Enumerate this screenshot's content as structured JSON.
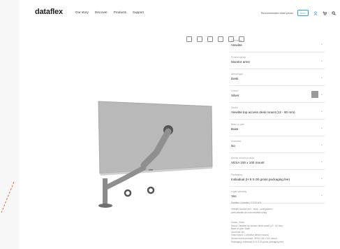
{
  "header": {
    "logo": "dataflex",
    "nav": [
      "Our story",
      "Discover",
      "Products",
      "Support"
    ],
    "price_label": "Recommended retail prices",
    "toggle": "EXCL"
  },
  "configurator": {
    "options": [
      {
        "key": "Collection",
        "value": "Viewlite"
      },
      {
        "key": "Product group",
        "value": "Monitor arms"
      },
      {
        "key": "Arrival type",
        "value": "Desk"
      },
      {
        "key": "Colour",
        "value": "Silver"
      },
      {
        "key": "Mount",
        "value": "Viewlite top access desk mount (12 - 60 mm)"
      },
      {
        "key": "Base or pole",
        "value": "Base"
      },
      {
        "key": "Grommet",
        "value": "No"
      },
      {
        "key": "Device mount product",
        "value": "VESA 100 x 100 mount"
      },
      {
        "key": "Packaging",
        "value": "Individual (H 6 S 00 gross packaging fee)"
      },
      {
        "key": "Legal warranty",
        "value": "Yes"
      }
    ],
    "summary_title": "Dataflex | Viewlite | 3 TOS 601",
    "summary_lines": [
      "Viewlite monitor arm - desk - configuration",
      "www.dataflex-int.com/viewlite/config"
    ],
    "details_lines": [
      "Colour: Silver",
      "Mount: Viewlite top access desk mount (12 - 60 mm)",
      "Base or pole: Base",
      "Grommet: No",
      "Vesa mount: 1 (Monitor device mount)",
      "Device mount product: VESA 100 x 100 mount",
      "Packaging: Individual (H 6 S 00 gross packaging fee)"
    ]
  },
  "colors": {
    "accent": "#3a9bd9",
    "monitor": "#b9b9b9",
    "arm": "#8f8f8f",
    "swatch": "#9a9a9a"
  }
}
